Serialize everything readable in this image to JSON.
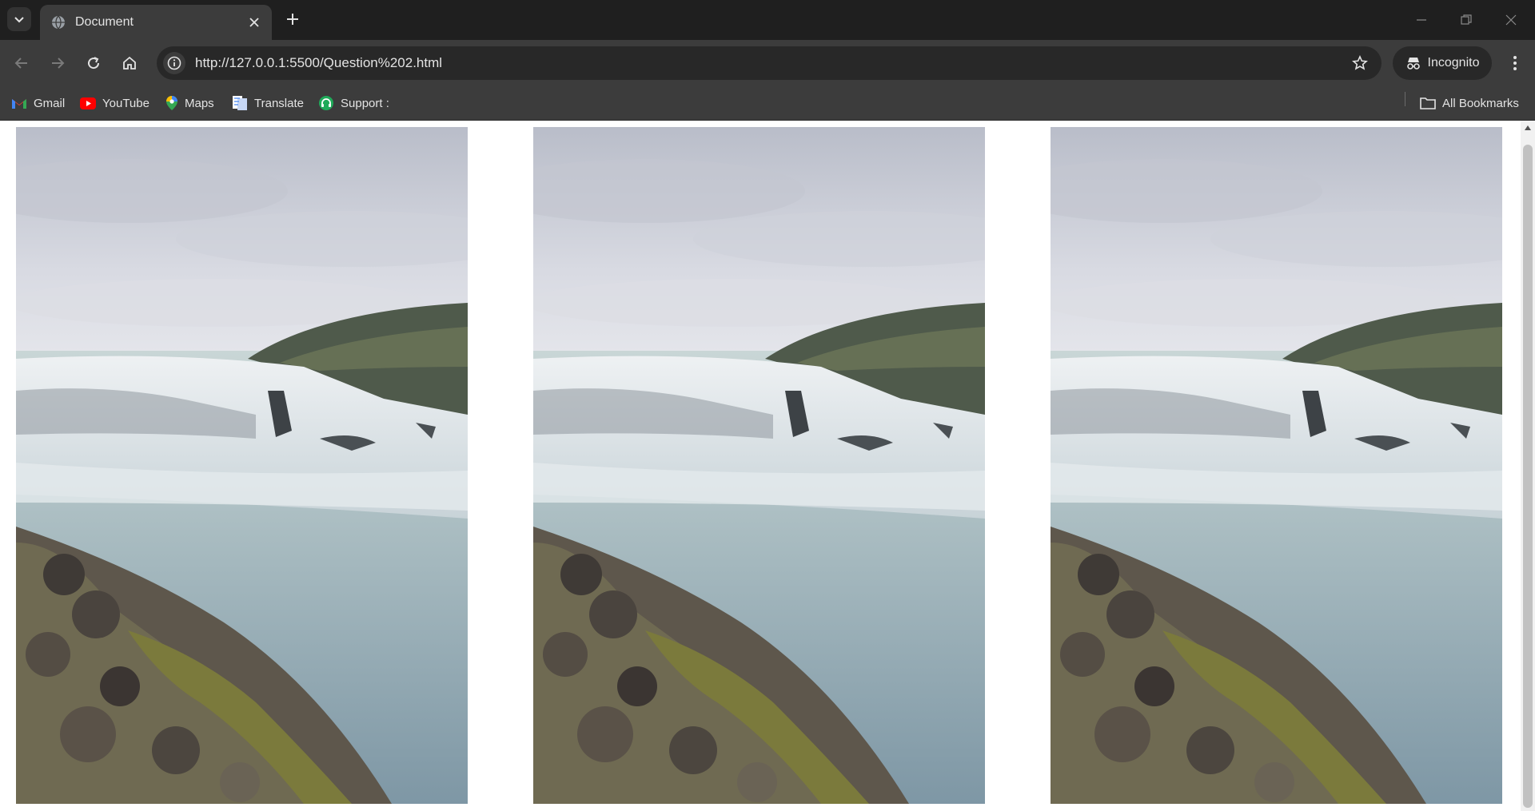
{
  "tab": {
    "title": "Document"
  },
  "toolbar": {
    "url": "http://127.0.0.1:5500/Question%202.html",
    "incognito_label": "Incognito"
  },
  "bookmarks": {
    "items": [
      {
        "label": "Gmail",
        "icon": "gmail-icon"
      },
      {
        "label": "YouTube",
        "icon": "youtube-icon"
      },
      {
        "label": "Maps",
        "icon": "maps-icon"
      },
      {
        "label": "Translate",
        "icon": "translate-icon"
      },
      {
        "label": "Support :",
        "icon": "support-icon"
      }
    ],
    "all_bookmarks_label": "All Bookmarks"
  },
  "images": [
    {
      "subject": "waterfall-photo"
    },
    {
      "subject": "waterfall-photo"
    },
    {
      "subject": "waterfall-photo"
    }
  ],
  "colors": {
    "chrome_dark": "#1f1f1f",
    "chrome_toolbar": "#3c3c3c",
    "omnibox": "#282828",
    "text": "#e3e3e3"
  }
}
